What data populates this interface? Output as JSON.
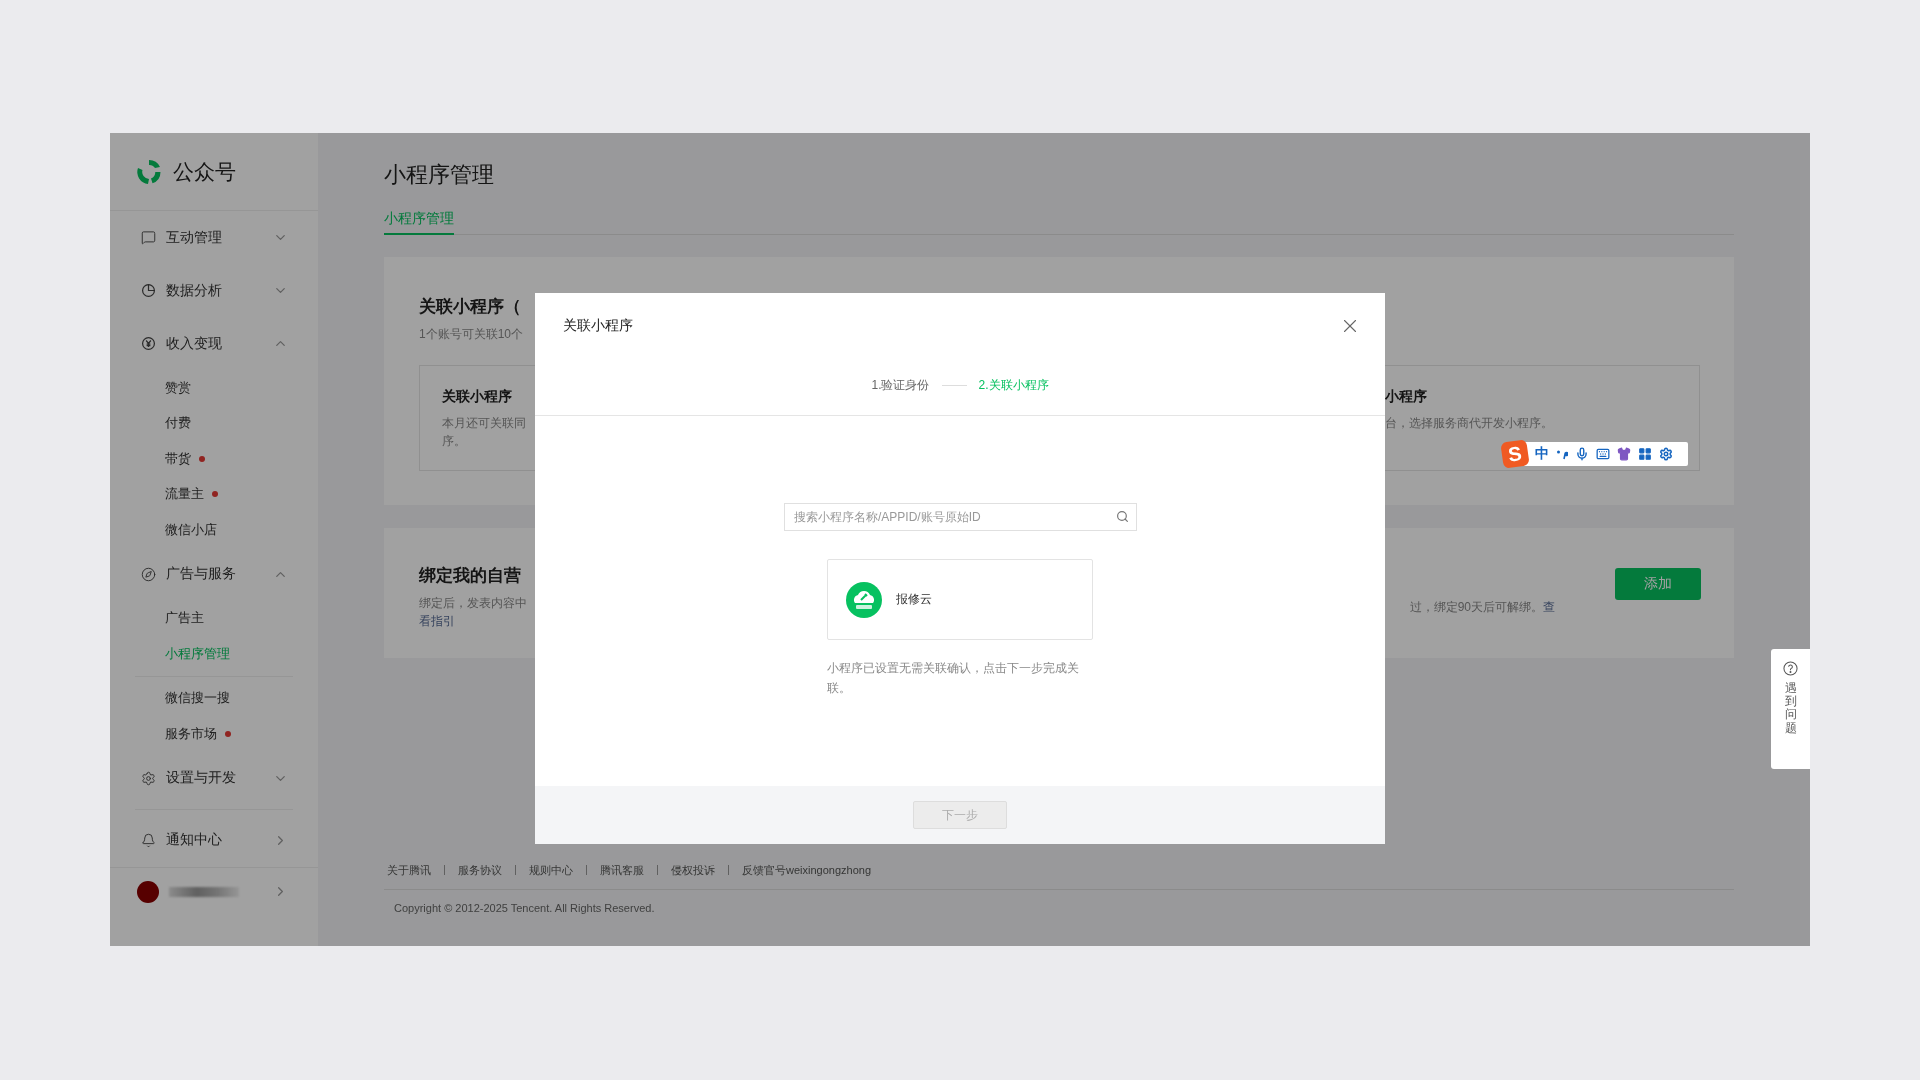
{
  "sidebar": {
    "brand": "公众号",
    "items": [
      {
        "kind": "group",
        "label": "互动管理",
        "expanded": false
      },
      {
        "kind": "group",
        "label": "数据分析",
        "expanded": false
      },
      {
        "kind": "group",
        "label": "收入变现",
        "expanded": true,
        "children": [
          {
            "label": "赞赏",
            "dot": false,
            "selected": false
          },
          {
            "label": "付费",
            "dot": false,
            "selected": false
          },
          {
            "label": "带货",
            "dot": true,
            "selected": false
          },
          {
            "label": "流量主",
            "dot": true,
            "selected": false
          },
          {
            "label": "微信小店",
            "dot": false,
            "selected": false
          }
        ]
      },
      {
        "kind": "group",
        "label": "广告与服务",
        "expanded": true,
        "children": [
          {
            "label": "广告主",
            "dot": false,
            "selected": false
          },
          {
            "label": "小程序管理",
            "dot": false,
            "selected": true
          },
          {
            "label": "微信搜一搜",
            "dot": false,
            "selected": false,
            "divider_before": true
          },
          {
            "label": "服务市场",
            "dot": true,
            "selected": false
          }
        ]
      },
      {
        "kind": "group",
        "label": "设置与开发",
        "expanded": false
      },
      {
        "kind": "link",
        "label": "通知中心"
      }
    ]
  },
  "page": {
    "title": "小程序管理",
    "tabs": [
      {
        "label": "小程序管理",
        "selected": true
      }
    ],
    "link_card": {
      "title": "关联小程序（",
      "subtitle": "1个账号可关联10个",
      "left_box": {
        "title": "关联小程序",
        "lines": [
          "本月还可关联同",
          "序。"
        ]
      },
      "right_box": {
        "title": "小程序",
        "subtitle": "台，选择服务商代开发小程序。"
      }
    },
    "bind_card": {
      "title": "绑定我的自营",
      "subtitle": "绑定后，发表内容中",
      "link_left": "看指引",
      "right_text": "过，绑定90天后可解绑。",
      "link_right": "查",
      "button": "添加"
    }
  },
  "footer": {
    "links": [
      "关于腾讯",
      "服务协议",
      "规则中心",
      "腾讯客服",
      "侵权投诉",
      "反馈官号weixingongzhong"
    ],
    "copyright": "Copyright © 2012-2025 Tencent. All Rights Reserved."
  },
  "help_tab": {
    "label": "遇到问题"
  },
  "ime_toolbar": {
    "logo": "S",
    "mode": "中"
  },
  "dialog": {
    "title": "关联小程序",
    "steps": [
      {
        "label": "1.验证身份",
        "selected": false
      },
      {
        "label": "2.关联小程序",
        "selected": true
      }
    ],
    "search": {
      "placeholder": "搜索小程序名称/APPID/账号原始ID"
    },
    "result": {
      "name": "报修云"
    },
    "note": "小程序已设置无需关联确认，点击下一步完成关联。",
    "next_button": {
      "label": "下一步",
      "disabled": true
    }
  }
}
